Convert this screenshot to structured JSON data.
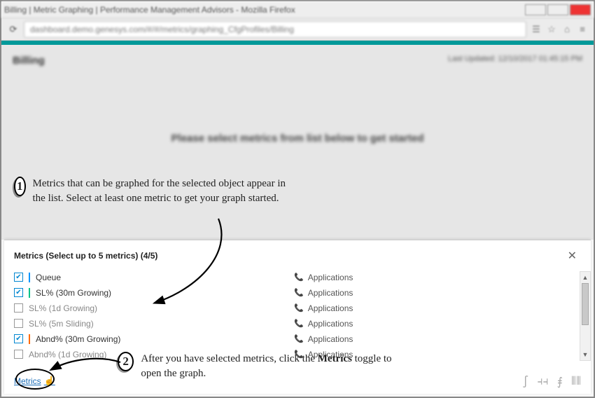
{
  "browser": {
    "title_blur": "Billing | Metric Graphing | Performance Management Advisors - Mozilla Firefox",
    "address_blur": "dashboard.demo.genesys.com/#/#/metrics/graphing_CfgProfiles/Billing"
  },
  "page": {
    "title_blur": "Billing",
    "last_updated_blur": "Last Updated: 12/10/2017 01:45:15 PM",
    "center_msg_blur": "Please select metrics from list below to get started"
  },
  "panel": {
    "title_prefix": "Metrics (Select up to 5 metrics) ",
    "count": "(4/5)",
    "metrics": [
      {
        "label": "Queue",
        "checked": true
      },
      {
        "label": "SL% (30m Growing)",
        "checked": true
      },
      {
        "label": "SL% (1d Growing)",
        "checked": false
      },
      {
        "label": "SL% (5m Sliding)",
        "checked": false
      },
      {
        "label": "Abnd% (30m Growing)",
        "checked": true
      },
      {
        "label": "Abnd% (1d Growing)",
        "checked": false
      }
    ],
    "app_label": "Applications",
    "toggle_label": "Metrics"
  },
  "annotations": {
    "one": "Metrics that can be graphed for the selected object appear in the list. Select at least one metric to get your graph started.",
    "two_a": "After you have selected metrics, click the ",
    "two_b": "Metrics",
    "two_c": " toggle to open the graph."
  }
}
